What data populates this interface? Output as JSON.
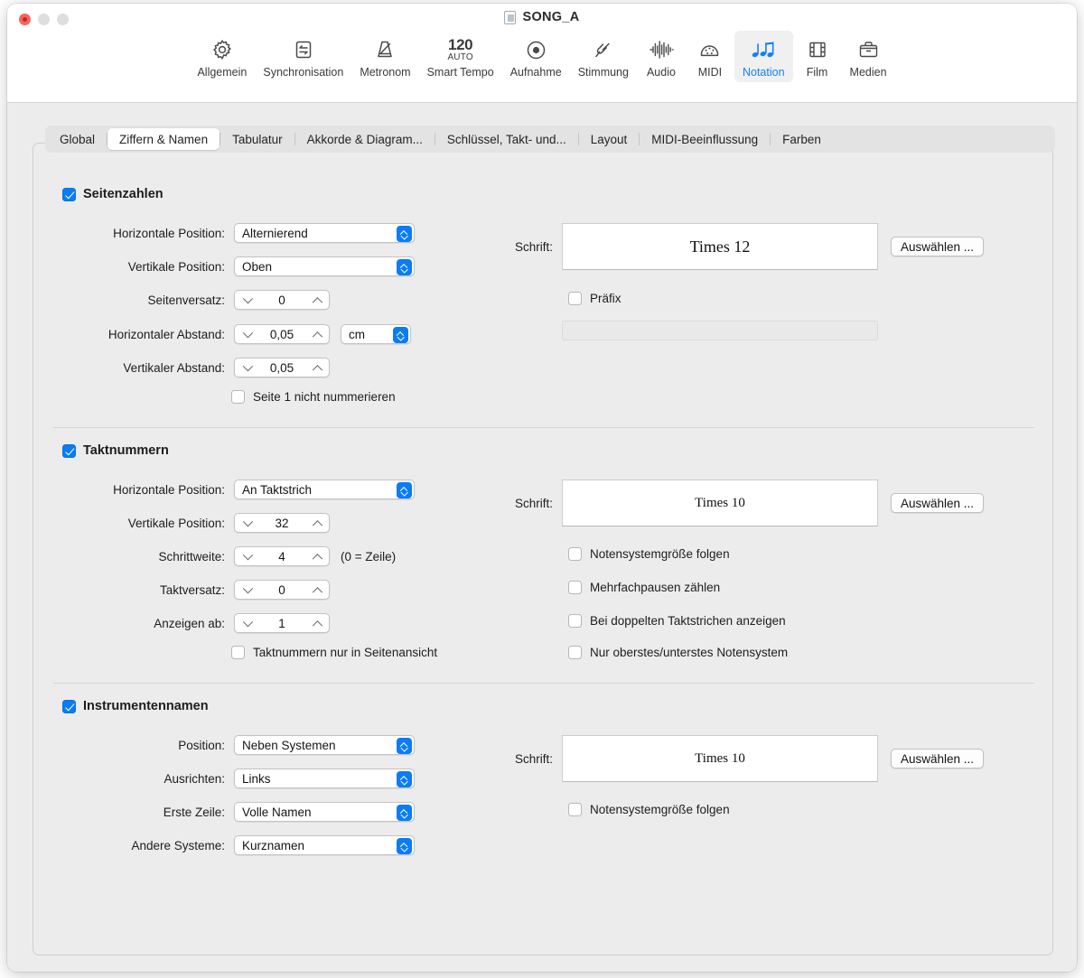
{
  "window": {
    "title": "SONG_A",
    "title_icon": "document-icon",
    "traffic_lights": [
      "close",
      "minimize",
      "maximize"
    ]
  },
  "toolbar": {
    "items": [
      {
        "label": "Allgemein",
        "icon": "gear-icon",
        "selected": false
      },
      {
        "label": "Synchronisation",
        "icon": "sync-arrows-icon",
        "selected": false
      },
      {
        "label": "Metronom",
        "icon": "metronome-icon",
        "selected": false
      },
      {
        "label": "Smart Tempo",
        "icon": "tempo-icon",
        "tempo": "120",
        "auto": "AUTO",
        "selected": false
      },
      {
        "label": "Aufnahme",
        "icon": "record-icon",
        "selected": false
      },
      {
        "label": "Stimmung",
        "icon": "tuning-fork-icon",
        "selected": false
      },
      {
        "label": "Audio",
        "icon": "waveform-icon",
        "selected": false
      },
      {
        "label": "MIDI",
        "icon": "midi-icon",
        "selected": false
      },
      {
        "label": "Notation",
        "icon": "notes-icon",
        "selected": true
      },
      {
        "label": "Film",
        "icon": "film-icon",
        "selected": false
      },
      {
        "label": "Medien",
        "icon": "briefcase-icon",
        "selected": false
      }
    ],
    "accent": "#1580f0"
  },
  "tabs": [
    {
      "label": "Global",
      "active": false
    },
    {
      "label": "Ziffern & Namen",
      "active": true
    },
    {
      "label": "Tabulatur",
      "active": false
    },
    {
      "label": "Akkorde & Diagram...",
      "active": false
    },
    {
      "label": "Schlüssel, Takt- und...",
      "active": false
    },
    {
      "label": "Layout",
      "active": false
    },
    {
      "label": "MIDI-Beeinflussung",
      "active": false
    },
    {
      "label": "Farben",
      "active": false
    }
  ],
  "sections": {
    "page_numbers": {
      "title": "Seitenzahlen",
      "enabled": true,
      "fields": [
        {
          "label": "Horizontale Position:",
          "type": "popup",
          "value": "Alternierend"
        },
        {
          "label": "Vertikale Position:",
          "type": "popup",
          "value": "Oben"
        },
        {
          "label": "Seitenversatz:",
          "type": "stepper",
          "value": "0"
        },
        {
          "label": "Horizontaler Abstand:",
          "type": "stepper",
          "value": "0,05",
          "unit": "cm"
        },
        {
          "label": "Vertikaler Abstand:",
          "type": "stepper",
          "value": "0,05"
        }
      ],
      "checkbox_left": {
        "label": "Seite 1 nicht nummerieren",
        "checked": false
      },
      "font_label": "Schrift:",
      "font_value": "Times 12",
      "font_button": "Auswählen ...",
      "prefix_checkbox": {
        "label": "Präfix",
        "checked": false
      },
      "prefix_value": ""
    },
    "bar_numbers": {
      "title": "Taktnummern",
      "enabled": true,
      "fields": [
        {
          "label": "Horizontale Position:",
          "type": "popup",
          "value": "An Taktstrich"
        },
        {
          "label": "Vertikale Position:",
          "type": "stepper",
          "value": "32"
        },
        {
          "label": "Schrittweite:",
          "type": "stepper",
          "value": "4",
          "hint": "(0 = Zeile)"
        },
        {
          "label": "Taktversatz:",
          "type": "stepper",
          "value": "0"
        },
        {
          "label": "Anzeigen ab:",
          "type": "stepper",
          "value": "1"
        }
      ],
      "checkbox_left": {
        "label": "Taktnummern nur in Seitenansicht",
        "checked": false
      },
      "font_label": "Schrift:",
      "font_value": "Times 10",
      "font_button": "Auswählen ...",
      "checkboxes_right": [
        {
          "label": "Notensystemgröße folgen",
          "checked": false
        },
        {
          "label": "Mehrfachpausen zählen",
          "checked": false
        },
        {
          "label": "Bei doppelten Taktstrichen anzeigen",
          "checked": false
        },
        {
          "label": "Nur oberstes/unterstes Notensystem",
          "checked": false
        }
      ]
    },
    "instrument_names": {
      "title": "Instrumentennamen",
      "enabled": true,
      "fields": [
        {
          "label": "Position:",
          "type": "popup",
          "value": "Neben Systemen"
        },
        {
          "label": "Ausrichten:",
          "type": "popup",
          "value": "Links"
        },
        {
          "label": "Erste Zeile:",
          "type": "popup",
          "value": "Volle Namen"
        },
        {
          "label": "Andere Systeme:",
          "type": "popup",
          "value": "Kurznamen"
        }
      ],
      "font_label": "Schrift:",
      "font_value": "Times 10",
      "font_button": "Auswählen ...",
      "checkboxes_right": [
        {
          "label": "Notensystemgröße folgen",
          "checked": false
        }
      ]
    }
  }
}
